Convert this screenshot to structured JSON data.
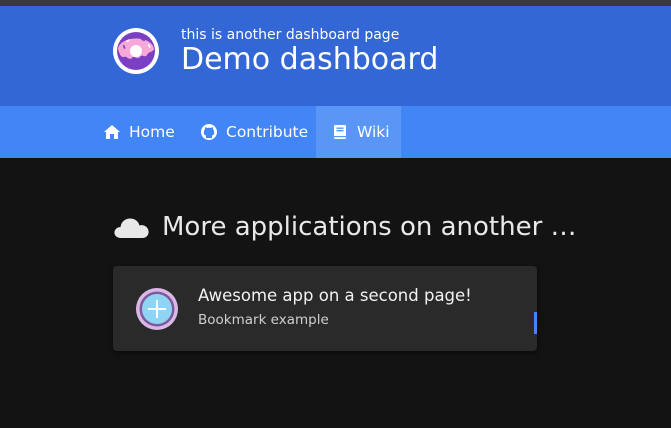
{
  "header": {
    "subtitle": "this is another dashboard page",
    "title": "Demo dashboard",
    "logo_icon": "donut-icon"
  },
  "nav": {
    "items": [
      {
        "label": "Home",
        "icon": "home-icon"
      },
      {
        "label": "Contribute",
        "icon": "github-icon"
      },
      {
        "label": "Wiki",
        "icon": "book-icon",
        "active": true
      }
    ]
  },
  "section": {
    "title": "More applications on another …",
    "icon": "cloud-icon"
  },
  "cards": [
    {
      "title": "Awesome app on a second page!",
      "subtitle": "Bookmark example",
      "icon": "plus-circle-icon"
    }
  ],
  "colors": {
    "header_bg": "#3367d6",
    "nav_bg": "#4285f4",
    "nav_active_bg": "#5996f6",
    "page_bg": "#131313",
    "card_bg": "#2a2a2a",
    "accent": "#4285f4"
  }
}
